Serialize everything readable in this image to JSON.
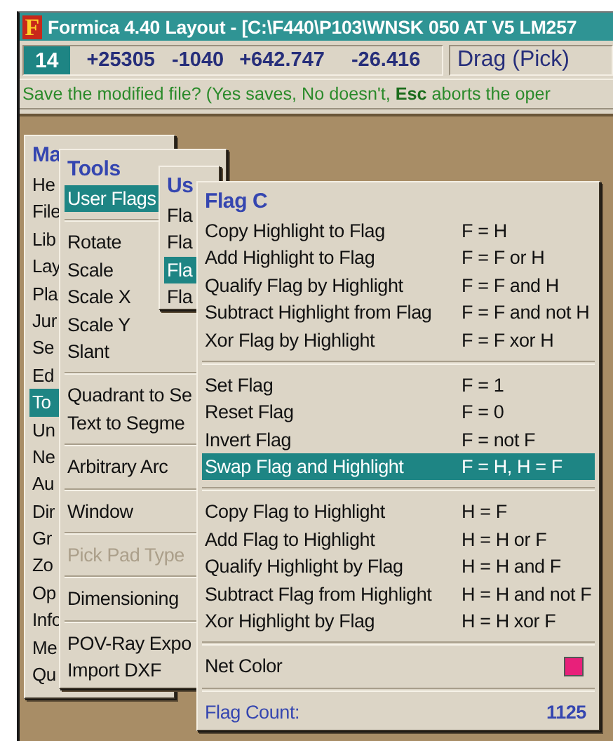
{
  "window": {
    "logo": "F",
    "title": "Formica 4.40 Layout - [C:\\F440\\P103\\WNSK 050 AT V5 LM257"
  },
  "status_bar": {
    "layer": "14",
    "readouts": [
      "+25305",
      "-1040",
      "+642.747",
      "-26.416"
    ],
    "mode": "Drag (Pick)"
  },
  "prompt": "Save the modified file?  (Yes saves, No doesn't, **Esc** aborts the oper",
  "menus": [
    {
      "title": "Ma",
      "items": [
        {
          "kind": "item",
          "label": "He",
          "selected": false
        },
        {
          "kind": "item",
          "label": "File",
          "selected": false
        },
        {
          "kind": "item",
          "label": "Lib",
          "selected": false
        },
        {
          "kind": "item",
          "label": "Lay",
          "selected": false
        },
        {
          "kind": "item",
          "label": "Pla",
          "selected": false
        },
        {
          "kind": "item",
          "label": "Jur",
          "selected": false
        },
        {
          "kind": "item",
          "label": "Se",
          "selected": false
        },
        {
          "kind": "item",
          "label": "Ed",
          "selected": false
        },
        {
          "kind": "item",
          "label": "To",
          "selected": true
        },
        {
          "kind": "item",
          "label": "Un",
          "selected": false
        },
        {
          "kind": "item",
          "label": "Ne",
          "selected": false
        },
        {
          "kind": "item",
          "label": "Au",
          "selected": false
        },
        {
          "kind": "item",
          "label": "Dir",
          "selected": false
        },
        {
          "kind": "item",
          "label": "Gr",
          "selected": false
        },
        {
          "kind": "item",
          "label": "Zo",
          "selected": false
        },
        {
          "kind": "item",
          "label": "Op",
          "selected": false
        },
        {
          "kind": "item",
          "label": "Info",
          "selected": false
        },
        {
          "kind": "item",
          "label": "Me",
          "selected": false
        },
        {
          "kind": "item",
          "label": "Qu",
          "selected": false
        }
      ]
    },
    {
      "title": "Tools",
      "items": [
        {
          "kind": "item",
          "label": "User Flags",
          "selected": true,
          "disabled": false
        },
        {
          "kind": "separator"
        },
        {
          "kind": "item",
          "label": "Rotate",
          "selected": false,
          "disabled": false
        },
        {
          "kind": "item",
          "label": "Scale",
          "selected": false,
          "disabled": false
        },
        {
          "kind": "item",
          "label": "Scale X",
          "selected": false,
          "disabled": false
        },
        {
          "kind": "item",
          "label": "Scale Y",
          "selected": false,
          "disabled": false
        },
        {
          "kind": "item",
          "label": "Slant",
          "selected": false,
          "disabled": false
        },
        {
          "kind": "separator"
        },
        {
          "kind": "item",
          "label": "Quadrant to Se",
          "selected": false,
          "disabled": false
        },
        {
          "kind": "item",
          "label": "Text to Segme",
          "selected": false,
          "disabled": false
        },
        {
          "kind": "separator"
        },
        {
          "kind": "item",
          "label": "Arbitrary Arc",
          "selected": false,
          "disabled": false
        },
        {
          "kind": "separator"
        },
        {
          "kind": "item",
          "label": "Window",
          "selected": false,
          "disabled": false
        },
        {
          "kind": "separator"
        },
        {
          "kind": "item",
          "label": "Pick Pad Type",
          "selected": false,
          "disabled": true
        },
        {
          "kind": "separator"
        },
        {
          "kind": "item",
          "label": "Dimensioning",
          "selected": false,
          "disabled": false
        },
        {
          "kind": "separator"
        },
        {
          "kind": "item",
          "label": "POV-Ray Expo",
          "selected": false,
          "disabled": false
        },
        {
          "kind": "item",
          "label": "Import DXF",
          "selected": false,
          "disabled": false
        }
      ]
    },
    {
      "title": "Us",
      "items": [
        {
          "kind": "item",
          "label": "Fla",
          "selected": false
        },
        {
          "kind": "item",
          "label": "Fla",
          "selected": false
        },
        {
          "kind": "item",
          "label": "Fla",
          "selected": true
        },
        {
          "kind": "item",
          "label": "Fla",
          "selected": false
        }
      ]
    },
    {
      "title": "Flag C",
      "items": [
        {
          "kind": "item",
          "label": "Copy Highlight to Flag",
          "shortcut": "F = H",
          "selected": false
        },
        {
          "kind": "item",
          "label": "Add Highlight to Flag",
          "shortcut": "F = F or H",
          "selected": false
        },
        {
          "kind": "item",
          "label": "Qualify Flag by Highlight",
          "shortcut": "F = F and H",
          "selected": false
        },
        {
          "kind": "item",
          "label": "Subtract Highlight from Flag",
          "shortcut": "F = F and not H",
          "selected": false
        },
        {
          "kind": "item",
          "label": "Xor Flag by Highlight",
          "shortcut": "F = F xor H",
          "selected": false
        },
        {
          "kind": "separator"
        },
        {
          "kind": "item",
          "label": "Set Flag",
          "shortcut": "F = 1",
          "selected": false
        },
        {
          "kind": "item",
          "label": "Reset Flag",
          "shortcut": "F = 0",
          "selected": false
        },
        {
          "kind": "item",
          "label": "Invert Flag",
          "shortcut": "F = not F",
          "selected": false
        },
        {
          "kind": "item",
          "label": "Swap Flag and Highlight",
          "shortcut": "F = H,  H = F",
          "selected": true
        },
        {
          "kind": "separator"
        },
        {
          "kind": "item",
          "label": "Copy Flag to Highlight",
          "shortcut": "H = F",
          "selected": false
        },
        {
          "kind": "item",
          "label": "Add Flag to Highlight",
          "shortcut": "H = H or F",
          "selected": false
        },
        {
          "kind": "item",
          "label": "Qualify Highlight by Flag",
          "shortcut": "H = H and F",
          "selected": false
        },
        {
          "kind": "item",
          "label": "Subtract Flag from Highlight",
          "shortcut": "H = H and not F",
          "selected": false
        },
        {
          "kind": "item",
          "label": "Xor Highlight by Flag",
          "shortcut": "H = H xor F",
          "selected": false
        },
        {
          "kind": "separator"
        },
        {
          "kind": "color",
          "label": "Net Color",
          "color": "#e8207a",
          "selected": false
        },
        {
          "kind": "separator"
        },
        {
          "kind": "count",
          "label": "Flag Count:",
          "value": "1125"
        }
      ]
    }
  ]
}
